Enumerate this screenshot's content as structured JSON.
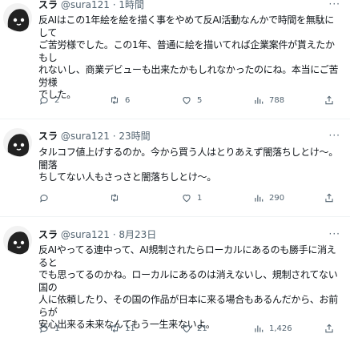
{
  "tweets": [
    {
      "name": "スラ",
      "handle": "@sura121",
      "time": "1時間",
      "text": "反AIはこの1年絵を絵を描く事をやめて反AI活動なんかで時間を無駄にして\nご苦労様でした。この1年、普通に絵を描いてれば企業案件が貰えたかもし\nれないし、商業デビューも出来たかもしれなかったのにね。本当にご苦労様\nでした。",
      "reply_count": "2",
      "retweet_count": "6",
      "like_count": "5",
      "view_count": "788"
    },
    {
      "name": "スラ",
      "handle": "@sura121",
      "time": "23時間",
      "text": "タルコフ値上げするのか。今から買う人はとりあえず闇落ちしとけ〜。闇落\nちしてない人もさっさと闇落ちしとけ〜。",
      "reply_count": "",
      "retweet_count": "",
      "like_count": "1",
      "view_count": "290"
    },
    {
      "name": "スラ",
      "handle": "@sura121",
      "time": "8月23日",
      "text": "反AIやってる連中って、AI規制されたらローカルにあるのも勝手に消えると\nでも思ってるのかね。ローカルにあるのは消えないし、規制されてない国の\n人に依頼したり、その国の作品が日本に来る場合もあるんだから、お前らが\n安心出来る未来なんてもう一生来ないよ。",
      "reply_count": "1",
      "retweet_count": "11",
      "like_count": "21",
      "view_count": "1,426"
    }
  ],
  "separator": " · ",
  "more_glyph": "···",
  "icons": [
    "reply-icon",
    "retweet-icon",
    "like-icon",
    "views-icon",
    "share-icon"
  ]
}
